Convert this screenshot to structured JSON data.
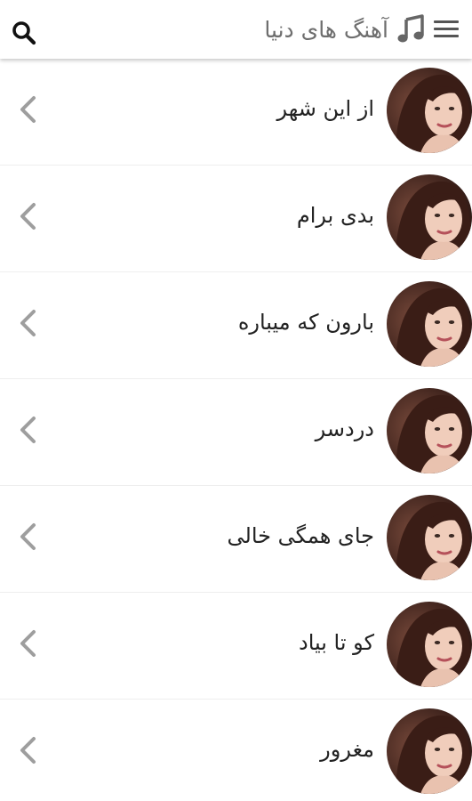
{
  "header": {
    "title": "آهنگ های دنیا",
    "menu_icon": "hamburger-menu-icon",
    "title_icon": "music-note-icon",
    "search_icon": "search-icon"
  },
  "songs": [
    {
      "title": "از این شهر"
    },
    {
      "title": "بدی برام"
    },
    {
      "title": "بارون که میباره"
    },
    {
      "title": "دردسر"
    },
    {
      "title": "جای همگی خالی"
    },
    {
      "title": "کو تا بیاد"
    },
    {
      "title": "مغرور"
    }
  ],
  "colors": {
    "header_text": "#6e6e6e",
    "song_text": "#222222",
    "chevron": "#9e9e9e",
    "divider": "#eeeeee"
  }
}
